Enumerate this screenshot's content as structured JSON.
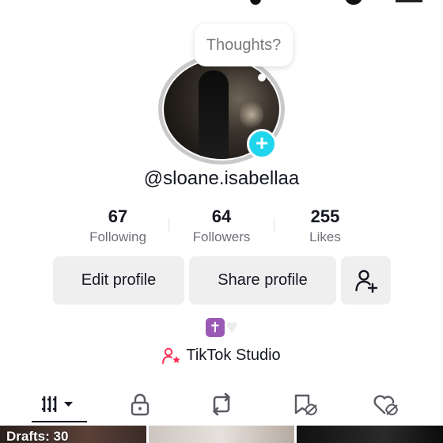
{
  "bubble": {
    "text": "Thoughts?"
  },
  "profile": {
    "username": "@sloane.isabellaa"
  },
  "stats": [
    {
      "value": "67",
      "label": "Following"
    },
    {
      "value": "64",
      "label": "Followers"
    },
    {
      "value": "255",
      "label": "Likes"
    }
  ],
  "buttons": {
    "edit": "Edit profile",
    "share": "Share profile"
  },
  "bio": {
    "emojis": "✝️🤍"
  },
  "studio": {
    "label": "TikTok Studio"
  },
  "tabs": [
    {
      "icon": "grid-videos-icon",
      "active": true
    },
    {
      "icon": "lock-icon"
    },
    {
      "icon": "repost-icon"
    },
    {
      "icon": "favorites-hidden-icon"
    },
    {
      "icon": "liked-hidden-icon"
    }
  ],
  "thumbnails": {
    "drafts_label": "Drafts: 30"
  },
  "colors": {
    "accent_cyan": "#20d5ec",
    "studio_pink": "#fe2c55",
    "button_bg": "#efeff0",
    "text_primary": "#161823",
    "text_secondary": "#6f7079"
  }
}
